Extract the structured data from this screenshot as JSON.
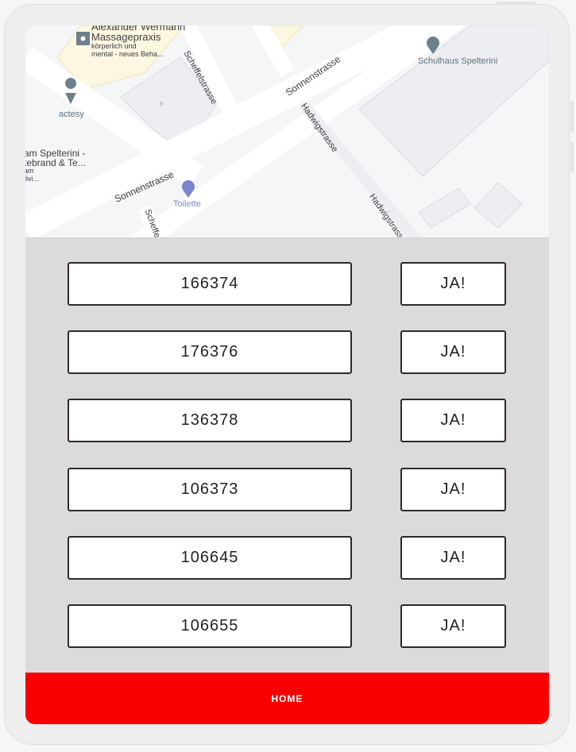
{
  "map": {
    "labels": {
      "poi_massage_line1": "Alexander Wermann",
      "poi_massage_line2": "Massagepraxis",
      "poi_massage_desc1": "körperlich und",
      "poi_massage_desc2": "mental - neues Beha...",
      "poi_actesy": "actesy",
      "poi_spelterini_1": "am Spelterini -",
      "poi_spelterini_2": "tebrand & Te...",
      "poi_spelterini_3": "am",
      "poi_spelterini_4": "divi...",
      "poi_toilette": "Toilette",
      "poi_school": "Schulhaus Spelterini",
      "street_sonnen_1": "Sonnenstrasse",
      "street_sonnen_2": "Sonnenstrasse",
      "street_scheffel_1": "Scheffelstrasse",
      "street_scheffel_2": "Scheffe",
      "street_hadwig_1": "Hadwigstrasse",
      "street_hadwig_2": "Hadwigstrass",
      "house_number": "9"
    }
  },
  "rows": [
    {
      "code": "166374",
      "button": "JA!"
    },
    {
      "code": "176376",
      "button": "JA!"
    },
    {
      "code": "136378",
      "button": "JA!"
    },
    {
      "code": "106373",
      "button": "JA!"
    },
    {
      "code": "106645",
      "button": "JA!"
    },
    {
      "code": "106655",
      "button": "JA!"
    }
  ],
  "footer": {
    "home_label": "HOME"
  },
  "colors": {
    "accent": "#f90000",
    "panel": "#dcdadb"
  }
}
